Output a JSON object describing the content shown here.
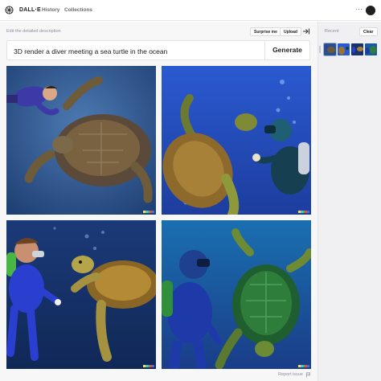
{
  "nav": {
    "brand": "DALL·E",
    "links": [
      "History",
      "Collections"
    ],
    "more_icon": "more-horizontal-icon"
  },
  "editor": {
    "hint": "Edit the detailed description",
    "surprise_label": "Surprise me",
    "upload_label": "Upload",
    "prompt": "3D render a diver meeting a sea turtle in the ocean",
    "generate_label": "Generate"
  },
  "results": {
    "images": [
      {
        "alt": "diver with sea turtle, top-left"
      },
      {
        "alt": "diver with sea turtle, top-right"
      },
      {
        "alt": "diver with sea turtle, bottom-left"
      },
      {
        "alt": "diver with sea turtle, bottom-right"
      }
    ],
    "report_label": "Report issue"
  },
  "sidebar": {
    "recent_label": "Recent",
    "clear_label": "Clear"
  },
  "colors": {
    "signature": [
      "#f4e04d",
      "#55c4d9",
      "#51b46d",
      "#e8503a",
      "#4a6fd8"
    ]
  }
}
